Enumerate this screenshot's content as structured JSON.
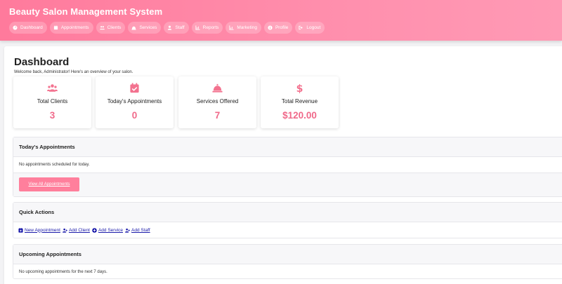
{
  "app": {
    "title": "Beauty Salon Management System"
  },
  "nav": [
    {
      "label": "Dashboard",
      "icon": "dashboard-icon"
    },
    {
      "label": "Appointments",
      "icon": "calendar-icon"
    },
    {
      "label": "Clients",
      "icon": "users-icon"
    },
    {
      "label": "Services",
      "icon": "bell-icon"
    },
    {
      "label": "Staff",
      "icon": "user-icon"
    },
    {
      "label": "Reports",
      "icon": "chart-icon"
    },
    {
      "label": "Marketing",
      "icon": "chart-icon"
    },
    {
      "label": "Profile",
      "icon": "info-icon"
    },
    {
      "label": "Logout",
      "icon": "logout-icon"
    }
  ],
  "page": {
    "title": "Dashboard",
    "subtitle": "Welcome back, Administrator! Here's an overview of your salon."
  },
  "stats": [
    {
      "label": "Total Clients",
      "value": "3",
      "icon": "users-icon"
    },
    {
      "label": "Today's Appointments",
      "value": "0",
      "icon": "calendar-check-icon"
    },
    {
      "label": "Services Offered",
      "value": "7",
      "icon": "concierge-bell-icon"
    },
    {
      "label": "Total Revenue",
      "value": "$120.00",
      "icon": "dollar-icon"
    }
  ],
  "today": {
    "title": "Today's Appointments",
    "empty": "No appointments scheduled for today.",
    "button": "View All Appointments"
  },
  "quick": {
    "title": "Quick Actions",
    "links": [
      {
        "label": "New Appointment",
        "icon": "calendar-plus-icon"
      },
      {
        "label": "Add Client",
        "icon": "user-plus-icon"
      },
      {
        "label": "Add Service",
        "icon": "plus-circle-icon"
      },
      {
        "label": "Add Staff",
        "icon": "user-plus-icon"
      }
    ]
  },
  "upcoming": {
    "title": "Upcoming Appointments",
    "empty": "No upcoming appointments for the next 7 days."
  },
  "colors": {
    "header": "#ff7a9c",
    "accent": "#f0698a",
    "link": "#1a1aaa"
  }
}
